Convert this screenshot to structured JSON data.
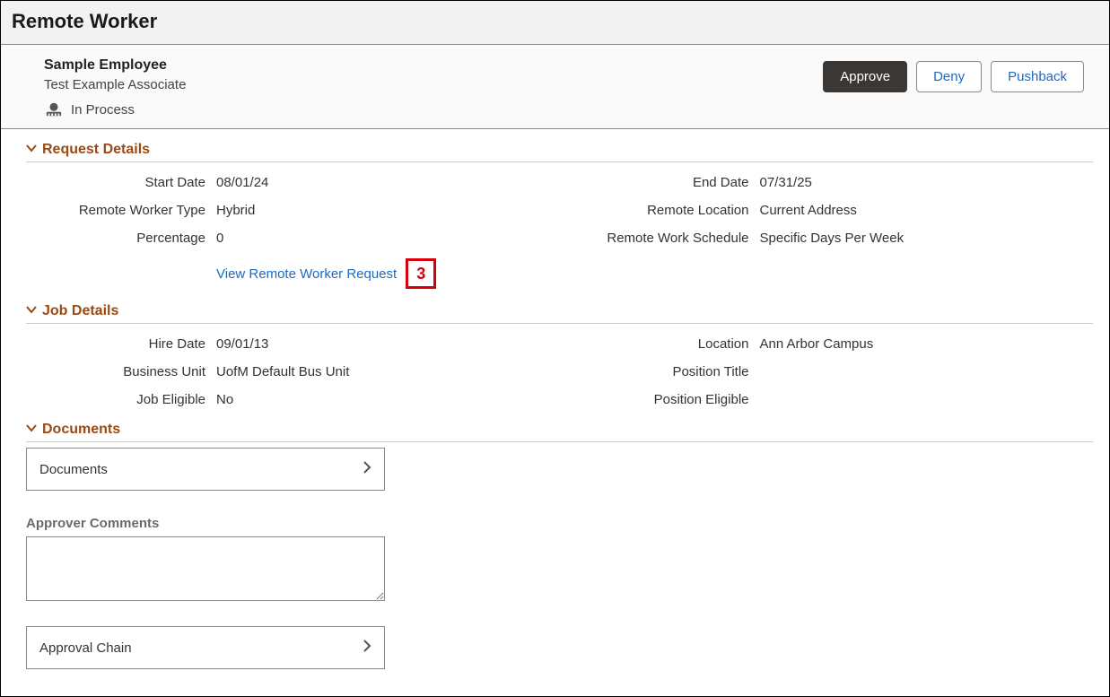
{
  "page_title": "Remote Worker",
  "employee": {
    "name": "Sample Employee",
    "title": "Test Example Associate",
    "status": "In Process"
  },
  "actions": {
    "approve": "Approve",
    "deny": "Deny",
    "pushback": "Pushback"
  },
  "sections": {
    "request_details": {
      "heading": "Request Details",
      "fields": {
        "start_date_label": "Start Date",
        "start_date": "08/01/24",
        "end_date_label": "End Date",
        "end_date": "07/31/25",
        "rwt_label": "Remote Worker Type",
        "rwt": "Hybrid",
        "rloc_label": "Remote Location",
        "rloc": "Current Address",
        "pct_label": "Percentage",
        "pct": "0",
        "sched_label": "Remote Work Schedule",
        "sched": "Specific Days Per Week"
      },
      "link_text": "View Remote Worker Request",
      "callout": "3"
    },
    "job_details": {
      "heading": "Job Details",
      "fields": {
        "hire_label": "Hire Date",
        "hire": "09/01/13",
        "loc_label": "Location",
        "loc": "Ann Arbor Campus",
        "bu_label": "Business Unit",
        "bu": "UofM Default Bus Unit",
        "pt_label": "Position Title",
        "pt": "",
        "je_label": "Job Eligible",
        "je": "No",
        "pe_label": "Position Eligible",
        "pe": ""
      }
    },
    "documents": {
      "heading": "Documents",
      "button_label": "Documents"
    },
    "approver_comments": {
      "label": "Approver Comments",
      "value": ""
    },
    "approval_chain": {
      "button_label": "Approval Chain"
    }
  }
}
